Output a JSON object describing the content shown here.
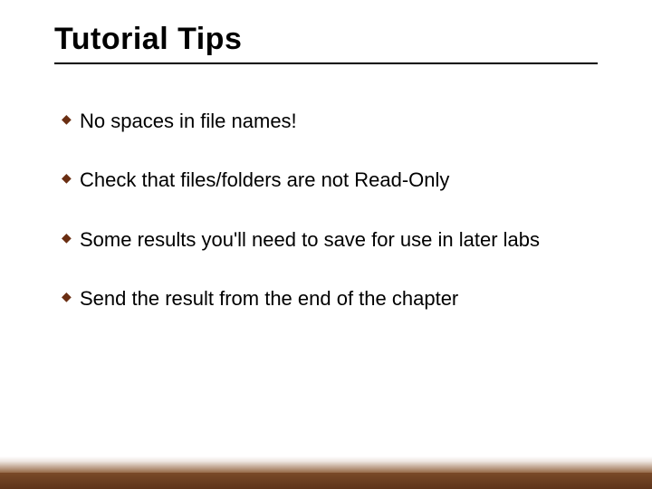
{
  "title": "Tutorial Tips",
  "bullet_glyph": "◆",
  "colors": {
    "accent": "#6a2e12",
    "rule": "#000000",
    "footer_top": "#8a5a33",
    "footer_bottom": "#5e341a"
  },
  "items": [
    {
      "text": "No spaces in file names!"
    },
    {
      "text": "Check that files/folders are not Read-Only"
    },
    {
      "text": "Some results you'll need to save for use in later labs"
    },
    {
      "text": "Send the result from the end of the chapter"
    }
  ]
}
